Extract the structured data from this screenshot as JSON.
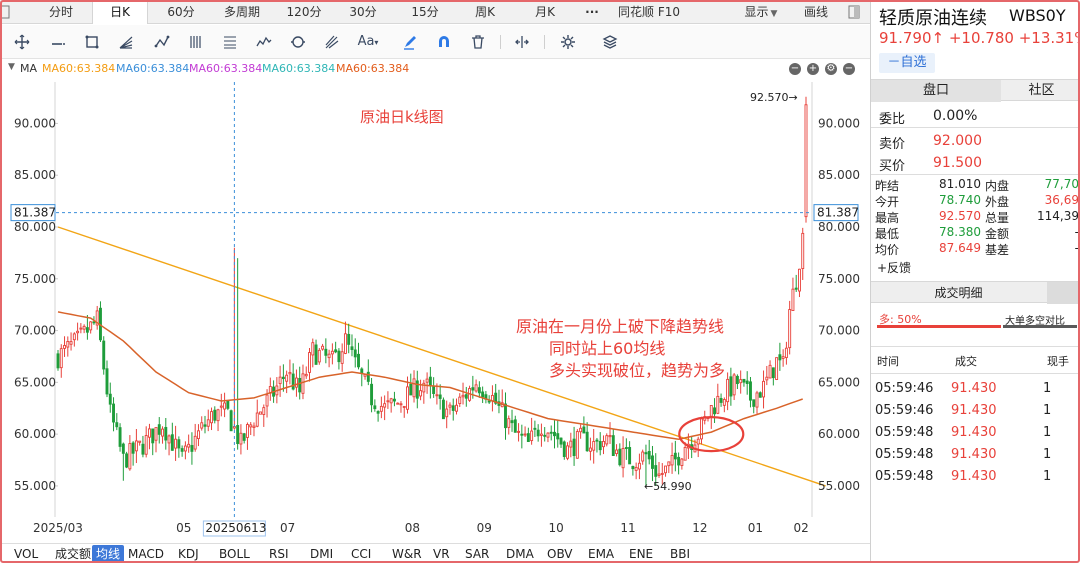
{
  "tabs": {
    "fenshi": "分时",
    "daily": "日K",
    "m60": "60分",
    "multi": "多周期",
    "m120": "120分",
    "m30": "30分",
    "m15": "15分",
    "weekly": "周K",
    "monthly": "月K",
    "more": "···",
    "f10": "同花顺 F10",
    "display": "显示",
    "draw": "画线"
  },
  "ma_legend": {
    "label": "MA",
    "items": [
      "MA60:63.384",
      "MA60:63.384",
      "MA60:63.384",
      "MA60:63.384",
      "MA60:63.384"
    ],
    "colors": [
      "#f39c12",
      "#3b8fd9",
      "#c23bd4",
      "#2fb6b6",
      "#e25c1b"
    ]
  },
  "instrument": {
    "name": "轻质原油连续",
    "code": "WBS0Y",
    "price": "91.790",
    "arrow": "↑",
    "change": "+10.780",
    "change_pct": "+13.31%",
    "watch_btn": "－自选"
  },
  "panel_tabs": {
    "pankou": "盘口",
    "shequ": "社区"
  },
  "quote": {
    "weibi_label": "委比",
    "weibi_value": "0.00%",
    "sell_label": "卖价",
    "sell_value": "92.000",
    "buy_label": "买价",
    "buy_value": "91.500"
  },
  "stats": [
    {
      "l": "昨结",
      "v": "81.010",
      "l2": "内盘",
      "v2": "77,70",
      "c": "#222222",
      "c2": "#1f9d3b"
    },
    {
      "l": "今开",
      "v": "78.740",
      "l2": "外盘",
      "v2": "36,69",
      "c": "#1f9d3b",
      "c2": "#e8413a"
    },
    {
      "l": "最高",
      "v": "92.570",
      "l2": "总量",
      "v2": "114,39",
      "c": "#e8413a",
      "c2": "#222222"
    },
    {
      "l": "最低",
      "v": "78.380",
      "l2": "金额",
      "v2": "-",
      "c": "#1f9d3b",
      "c2": "#222222"
    },
    {
      "l": "均价",
      "v": "87.649",
      "l2": "基差",
      "v2": "-",
      "c": "#e8413a",
      "c2": "#222222"
    }
  ],
  "feedback": "+反馈",
  "trades": {
    "title": "成交明细",
    "ratio_label": "多: 50%",
    "ratio_right": "大单多空对比",
    "cols": [
      "时间",
      "成交",
      "现手"
    ],
    "rows": [
      {
        "time": "05:59:46",
        "price": "91.430",
        "vol": "1"
      },
      {
        "time": "05:59:46",
        "price": "91.430",
        "vol": "1"
      },
      {
        "time": "05:59:48",
        "price": "91.430",
        "vol": "1"
      },
      {
        "time": "05:59:48",
        "price": "91.430",
        "vol": "1"
      },
      {
        "time": "05:59:48",
        "price": "91.430",
        "vol": "1"
      }
    ]
  },
  "indicators": [
    "VOL",
    "成交额",
    "均线",
    "MACD",
    "KDJ",
    "BOLL",
    "RSI",
    "DMI",
    "CCI",
    "W&R",
    "VR",
    "SAR",
    "DMA",
    "OBV",
    "EMA",
    "ENE",
    "BBI"
  ],
  "chart_annotations": {
    "title": "原油日k线图",
    "note_line1": "原油在一月份上破下降趋势线",
    "note_line2": "同时站上60均线",
    "note_line3": "多头实现破位，趋势为多",
    "high_label": "92.570→",
    "low_label": "←54.990",
    "crosshair_price": "81.387",
    "crosshair_date": "20250613"
  },
  "chart_data": {
    "type": "candlestick",
    "title": "原油日k线图",
    "y_ticks": [
      "90.000",
      "85.000",
      "80.000",
      "75.000",
      "70.000",
      "65.000",
      "60.000",
      "55.000"
    ],
    "x_ticks": [
      "2025/03",
      "05",
      "07",
      "08",
      "09",
      "10",
      "11",
      "12",
      "01",
      "02"
    ],
    "ylim": [
      52,
      94
    ],
    "anchors": [
      [
        0,
        67.5
      ],
      [
        6,
        69
      ],
      [
        12,
        71
      ],
      [
        16,
        62
      ],
      [
        20,
        57.5
      ],
      [
        26,
        59
      ],
      [
        32,
        61
      ],
      [
        38,
        57.5
      ],
      [
        44,
        60.5
      ],
      [
        48,
        62
      ],
      [
        52,
        62
      ],
      [
        56,
        59
      ],
      [
        60,
        61.5
      ],
      [
        66,
        64
      ],
      [
        70,
        66
      ],
      [
        74,
        64
      ],
      [
        78,
        68
      ],
      [
        84,
        67
      ],
      [
        88,
        69
      ],
      [
        92,
        66
      ],
      [
        96,
        63.5
      ],
      [
        100,
        62.5
      ],
      [
        104,
        63
      ],
      [
        108,
        64
      ],
      [
        112,
        65
      ],
      [
        116,
        63
      ],
      [
        120,
        62
      ],
      [
        124,
        63.5
      ],
      [
        128,
        65
      ],
      [
        132,
        64
      ],
      [
        136,
        62
      ],
      [
        140,
        60
      ],
      [
        144,
        59
      ],
      [
        148,
        61
      ],
      [
        152,
        60
      ],
      [
        156,
        58.5
      ],
      [
        160,
        59.5
      ],
      [
        164,
        59
      ],
      [
        168,
        59.5
      ],
      [
        172,
        58
      ],
      [
        176,
        57.5
      ],
      [
        180,
        58
      ],
      [
        184,
        56
      ],
      [
        188,
        57
      ],
      [
        192,
        59
      ],
      [
        196,
        60
      ],
      [
        200,
        62.5
      ],
      [
        204,
        64
      ],
      [
        208,
        65
      ],
      [
        212,
        63.5
      ],
      [
        216,
        64.5
      ],
      [
        220,
        67
      ],
      [
        222,
        66.5
      ],
      [
        224,
        72
      ],
      [
        226,
        75
      ],
      [
        228,
        79
      ],
      [
        229,
        91.5
      ]
    ],
    "ma60": [
      [
        0,
        71.8
      ],
      [
        10,
        71.2
      ],
      [
        20,
        69
      ],
      [
        30,
        66
      ],
      [
        40,
        64
      ],
      [
        50,
        63.2
      ],
      [
        60,
        63.5
      ],
      [
        70,
        64.5
      ],
      [
        80,
        65.5
      ],
      [
        90,
        66
      ],
      [
        100,
        65.5
      ],
      [
        110,
        64.8
      ],
      [
        120,
        64.5
      ],
      [
        130,
        63.5
      ],
      [
        140,
        62.5
      ],
      [
        150,
        61.5
      ],
      [
        160,
        61
      ],
      [
        170,
        60.5
      ],
      [
        180,
        60
      ],
      [
        190,
        59.5
      ],
      [
        200,
        60.2
      ],
      [
        210,
        61.5
      ],
      [
        220,
        62.5
      ],
      [
        229,
        63.5
      ]
    ],
    "trendline": [
      [
        0,
        80
      ],
      [
        235,
        55
      ]
    ],
    "high": {
      "date_index": 229,
      "value": 92.57
    },
    "low": {
      "date_index": 180,
      "value": 54.99
    },
    "crosshair": {
      "date_index": 54,
      "value": 81.387
    }
  }
}
